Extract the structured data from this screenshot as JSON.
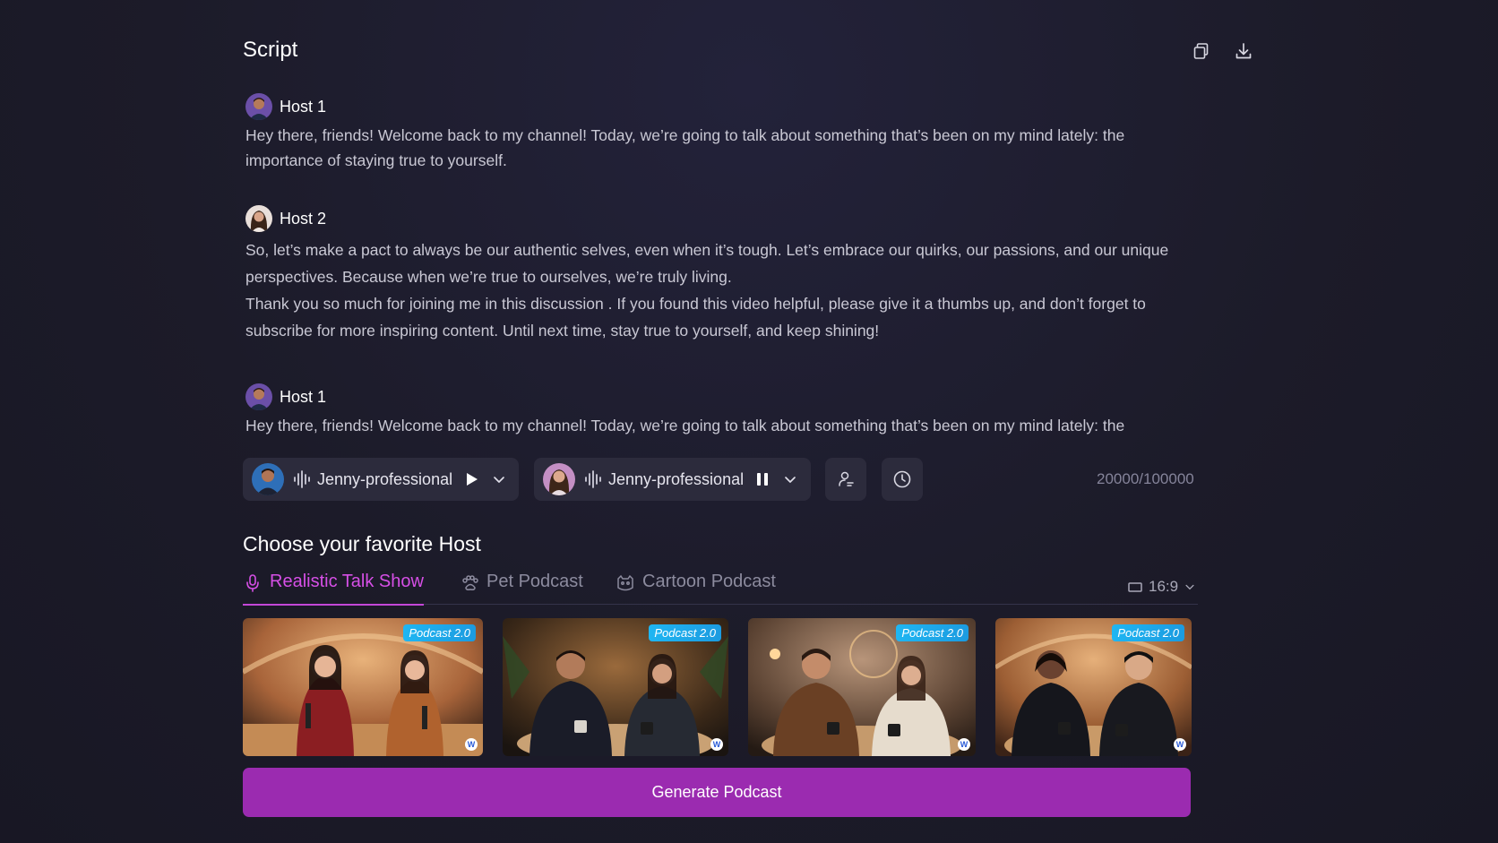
{
  "header": {
    "title": "Script",
    "copy_icon": "copy-icon",
    "download_icon": "download-icon"
  },
  "script": {
    "blocks": [
      {
        "speaker": "Host 1",
        "avatar": "male-avatar",
        "lines": [
          "Hey there, friends! Welcome back to my channel! Today, we’re going to talk about something that’s been on my mind lately: the importance of staying true to yourself."
        ]
      },
      {
        "speaker": "Host 2",
        "avatar": "female-avatar",
        "lines": [
          "So, let’s make a pact to always be our authentic selves, even when it’s tough. Let’s embrace our quirks, our passions, and our unique perspectives. Because when we’re true to ourselves, we’re truly living.",
          "Thank you so much for joining me in this discussion . If you found this video helpful, please give it a thumbs up, and don’t forget to subscribe for more inspiring content. Until next time, stay true to yourself, and keep shining!"
        ]
      },
      {
        "speaker": "Host 1",
        "avatar": "male-avatar",
        "lines": [
          "Hey there, friends! Welcome back to my channel! Today, we’re going to talk about something that’s been on my mind lately: the"
        ]
      }
    ]
  },
  "voices": [
    {
      "name": "Jenny-professional",
      "state": "play-icon",
      "avatar": "male-avatar"
    },
    {
      "name": "Jenny-professional",
      "state": "pause-icon",
      "avatar": "female-avatar"
    }
  ],
  "char_count": "20000/100000",
  "host_section": {
    "title": "Choose your favorite Host",
    "tabs": [
      {
        "label": "Realistic Talk Show",
        "icon": "microphone-icon",
        "active": true
      },
      {
        "label": "Pet Podcast",
        "icon": "paw-icon",
        "active": false
      },
      {
        "label": "Cartoon Podcast",
        "icon": "cartoon-icon",
        "active": false
      }
    ],
    "ratio": "16:9",
    "thumbnails": [
      {
        "badge": "Podcast 2.0"
      },
      {
        "badge": "Podcast 2.0"
      },
      {
        "badge": "Podcast 2.0"
      },
      {
        "badge": "Podcast 2.0"
      }
    ]
  },
  "generate_button": "Generate Podcast",
  "colors": {
    "background": "#1c1b29",
    "accent": "#9b2bb0",
    "tab_active": "#d64fe6",
    "badge": "#1fb6f2"
  }
}
